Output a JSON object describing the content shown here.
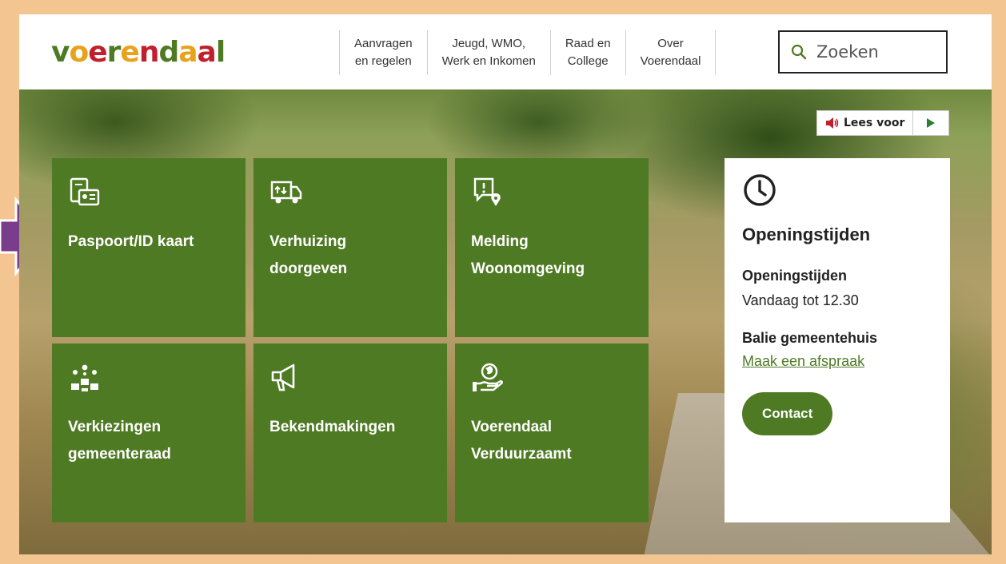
{
  "logo": {
    "text": "voerendaal",
    "letters": [
      {
        "ch": "v",
        "color": "#4e7a23"
      },
      {
        "ch": "o",
        "color": "#e8a31c"
      },
      {
        "ch": "e",
        "color": "#c0202c"
      },
      {
        "ch": "r",
        "color": "#4e7a23"
      },
      {
        "ch": "e",
        "color": "#e8a31c"
      },
      {
        "ch": "n",
        "color": "#c0202c"
      },
      {
        "ch": "d",
        "color": "#4e7a23"
      },
      {
        "ch": "a",
        "color": "#e8a31c"
      },
      {
        "ch": "a",
        "color": "#c0202c"
      },
      {
        "ch": "l",
        "color": "#4e7a23"
      }
    ]
  },
  "nav": [
    {
      "label": "Aanvragen\nen regelen"
    },
    {
      "label": "Jeugd, WMO,\nWerk en Inkomen"
    },
    {
      "label": "Raad en\nCollege"
    },
    {
      "label": "Over\nVoerendaal"
    }
  ],
  "search": {
    "placeholder": "Zoeken",
    "icon": "search-icon"
  },
  "lees_voor": {
    "label": "Lees voor",
    "icon": "speaker-icon",
    "play_icon": "play-icon"
  },
  "tiles": [
    {
      "label": "Paspoort/ID kaart",
      "icon": "passport-icon"
    },
    {
      "label": "Verhuizing\ndoorgeven",
      "icon": "moving-truck-icon"
    },
    {
      "label": "Melding\nWoonomgeving",
      "icon": "report-location-icon"
    },
    {
      "label": "Verkiezingen\ngemeenteraad",
      "icon": "people-vote-icon"
    },
    {
      "label": "Bekendmakingen",
      "icon": "megaphone-icon"
    },
    {
      "label": "Voerendaal\nVerduurzaamt",
      "icon": "globe-hand-icon"
    }
  ],
  "opening": {
    "icon": "clock-icon",
    "title": "Openingstijden",
    "subtitle": "Openingstijden",
    "today": "Vandaag tot 12.30",
    "balie": "Balie gemeentehuis",
    "link": "Maak een afspraak",
    "button": "Contact"
  },
  "colors": {
    "brand_green": "#4e7a23",
    "frame": "#f3c590",
    "arrow": "#7a3d8c"
  }
}
